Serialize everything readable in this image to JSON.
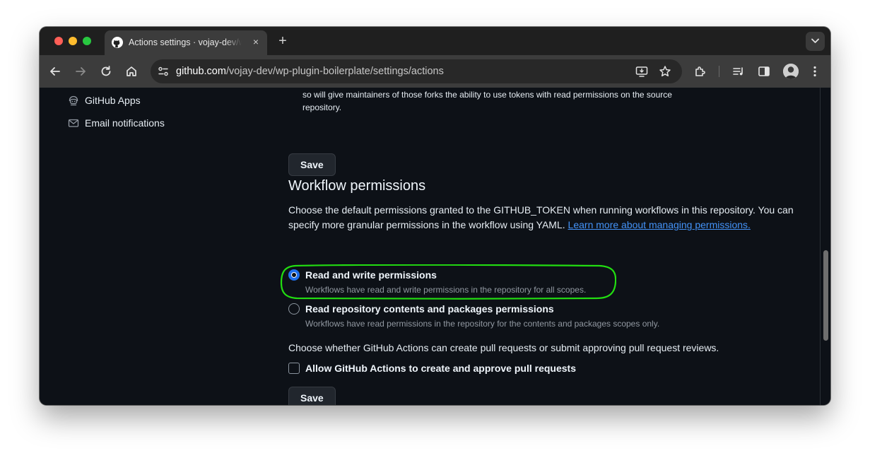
{
  "browser": {
    "tab_title": "Actions settings · vojay-dev/wp-plugin-boilerplate",
    "tab_close": "×",
    "new_tab": "+",
    "url_host": "github.com",
    "url_path": "/vojay-dev/wp-plugin-boilerplate/settings/actions"
  },
  "sidebar": {
    "items": [
      {
        "label": "GitHub Apps",
        "icon": "github-apps-icon"
      },
      {
        "label": "Email notifications",
        "icon": "mail-icon"
      }
    ]
  },
  "fork_section": {
    "text_line1": "so will give maintainers of those forks the ability to use tokens with read permissions on the source",
    "text_line2": "repository.",
    "save_label": "Save"
  },
  "workflow_permissions": {
    "title": "Workflow permissions",
    "description": "Choose the default permissions granted to the GITHUB_TOKEN when running workflows in this repository. You can specify more granular permissions in the workflow using YAML.",
    "learn_more": "Learn more about managing permissions.",
    "options": [
      {
        "label": "Read and write permissions",
        "note": "Workflows have read and write permissions in the repository for all scopes.",
        "checked": true
      },
      {
        "label": "Read repository contents and packages permissions",
        "note": "Workflows have read permissions in the repository for the contents and packages scopes only.",
        "checked": false
      }
    ],
    "pr_question": "Choose whether GitHub Actions can create pull requests or submit approving pull request reviews.",
    "pr_checkbox_label": "Allow GitHub Actions to create and approve pull requests",
    "save_label": "Save"
  },
  "colors": {
    "background": "#0d1117",
    "accent_blue": "#1f6feb",
    "link": "#4493f8",
    "highlight_annotation": "#22dd11"
  }
}
